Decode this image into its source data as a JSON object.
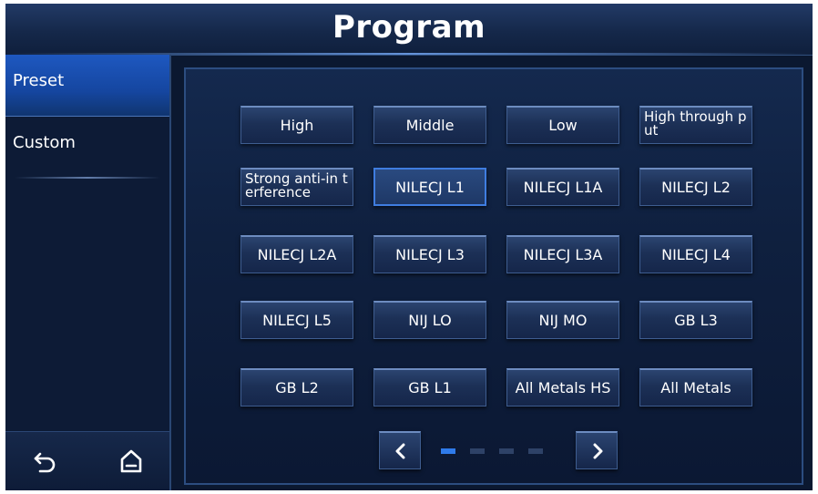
{
  "title": "Program",
  "sidebar": {
    "items": [
      {
        "label": "Preset",
        "selected": true
      },
      {
        "label": "Custom",
        "selected": false
      }
    ],
    "bottom_icons": [
      "back-icon",
      "home-icon"
    ]
  },
  "programs": [
    {
      "label": "High"
    },
    {
      "label": "Middle"
    },
    {
      "label": "Low"
    },
    {
      "label": "High through put"
    },
    {
      "label": "Strong anti-in terference"
    },
    {
      "label": "NILECJ L1",
      "selected": true
    },
    {
      "label": "NILECJ L1A"
    },
    {
      "label": "NILECJ L2"
    },
    {
      "label": "NILECJ L2A"
    },
    {
      "label": "NILECJ L3"
    },
    {
      "label": "NILECJ L3A"
    },
    {
      "label": "NILECJ L4"
    },
    {
      "label": "NILECJ L5"
    },
    {
      "label": "NIJ LO"
    },
    {
      "label": "NIJ MO"
    },
    {
      "label": "GB L3"
    },
    {
      "label": "GB L2"
    },
    {
      "label": "GB L1"
    },
    {
      "label": "All Metals HS"
    },
    {
      "label": "All Metals"
    }
  ],
  "pager": {
    "prev_icon": "chevron-left-icon",
    "next_icon": "chevron-right-icon",
    "total_pages": 4,
    "current_page": 1
  },
  "colors": {
    "accent": "#2f7bea",
    "background": "#0b1830",
    "selected_tab": "#1e58c0"
  }
}
